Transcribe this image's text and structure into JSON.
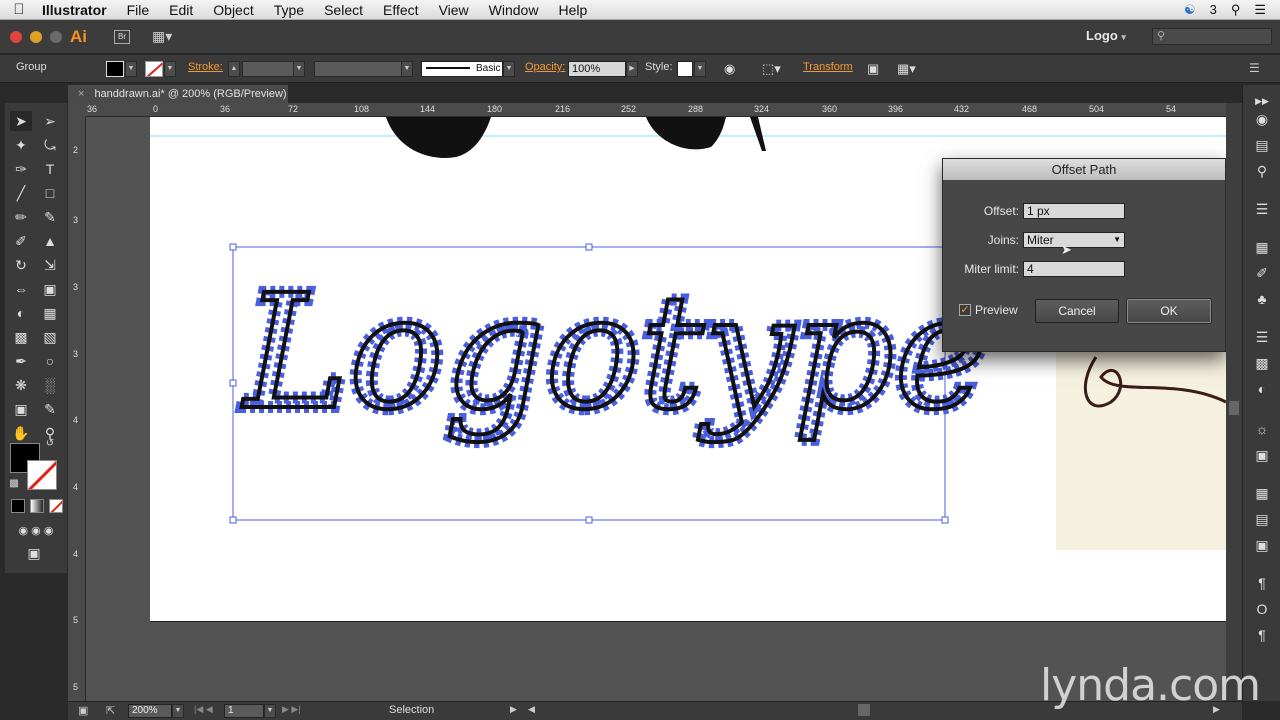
{
  "menubar": {
    "items": [
      "Illustrator",
      "File",
      "Edit",
      "Object",
      "Type",
      "Select",
      "Effect",
      "View",
      "Window",
      "Help"
    ],
    "cc_count": "3"
  },
  "appbar": {
    "app_logo": "Ai",
    "bridge_label": "Br",
    "workspace": "Logo"
  },
  "control": {
    "selection_type": "Group",
    "stroke_label": "Stroke:",
    "brush_label": "Basic",
    "opacity_label": "Opacity:",
    "opacity_value": "100%",
    "style_label": "Style:",
    "transform_label": "Transform"
  },
  "document": {
    "tab_title": "handdrawn.ai* @ 200% (RGB/Preview)"
  },
  "ruler": {
    "top_ticks": [
      "36",
      "0",
      "36",
      "72",
      "108",
      "144",
      "180",
      "216",
      "252",
      "288",
      "324",
      "360",
      "396",
      "432",
      "468",
      "504",
      "54"
    ],
    "left_ticks": [
      "2",
      "3",
      "3",
      "3",
      "4",
      "4",
      "4",
      "5",
      "5"
    ]
  },
  "artwork": {
    "logotype_text": "Logotype"
  },
  "dialog": {
    "title": "Offset Path",
    "offset_label": "Offset:",
    "offset_value": "1 px",
    "joins_label": "Joins:",
    "joins_value": "Miter",
    "miter_label": "Miter limit:",
    "miter_value": "4",
    "preview_label": "Preview",
    "preview_checked": true,
    "cancel_label": "Cancel",
    "ok_label": "OK"
  },
  "statusbar": {
    "zoom": "200%",
    "artboard_num": "1",
    "tool_name": "Selection"
  },
  "watermark": "lynda.com",
  "colors": {
    "accent": "#f29a3a",
    "selection": "#4a5fe0",
    "guide": "#7ee7ee"
  }
}
